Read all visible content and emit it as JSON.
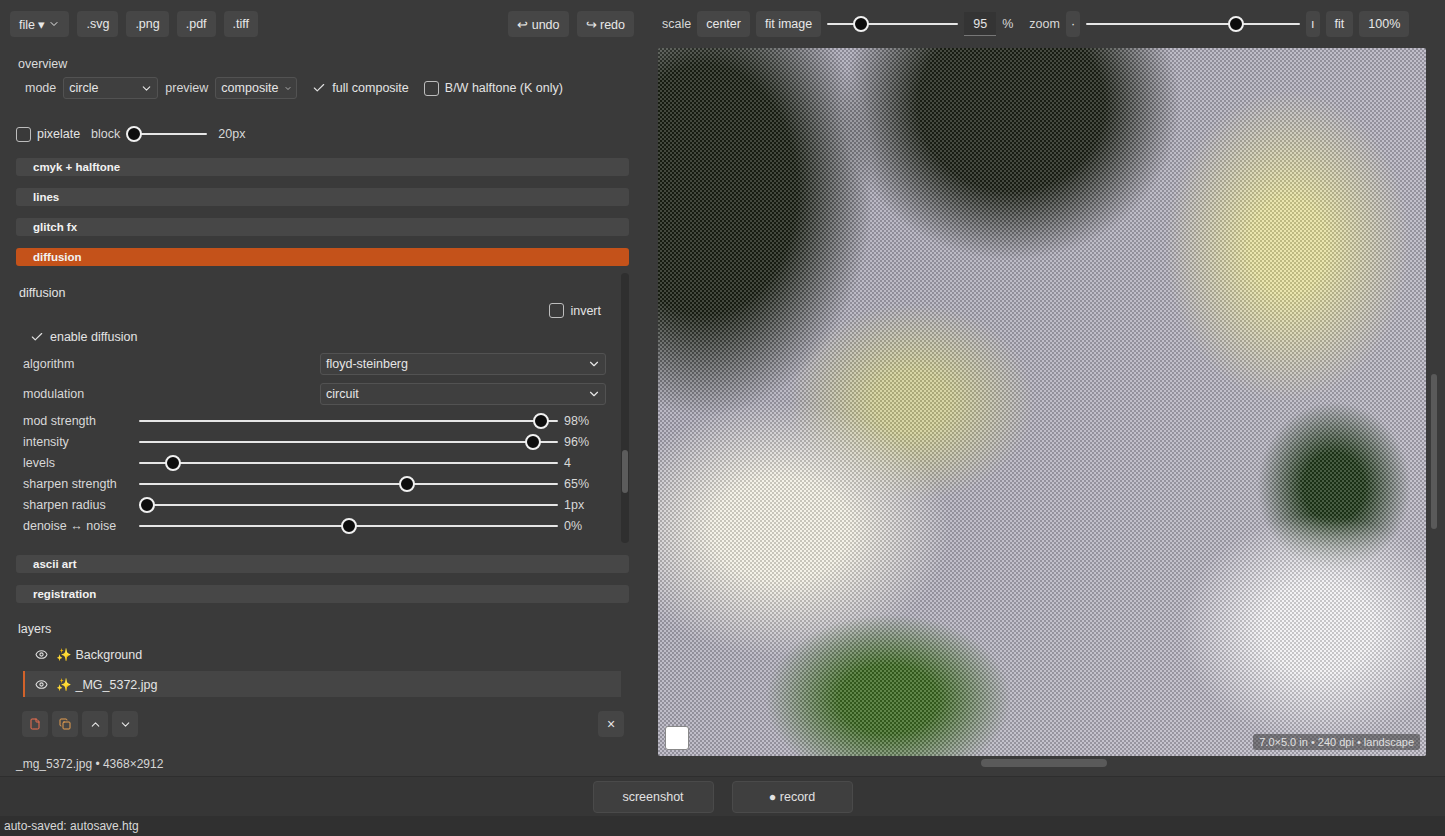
{
  "toolbar": {
    "file_menu": "file ▾",
    "exports": [
      ".svg",
      ".png",
      ".pdf",
      ".tiff"
    ],
    "undo": "↩ undo",
    "redo": "↪ redo"
  },
  "view": {
    "scale_label": "scale",
    "center": "center",
    "fit_image": "fit image",
    "scale_level": 0.26,
    "scale_value": "95",
    "percent": "%",
    "zoom_label": "zoom",
    "zoom_out": "·",
    "zoom_level": 0.7,
    "zoom_in": "ı",
    "fit": "fit",
    "actual": "100%"
  },
  "overview": {
    "title": "overview",
    "mode_label": "mode",
    "mode": "circle",
    "preview_label": "preview",
    "preview": "composite",
    "options": [
      {
        "label": "full composite",
        "checked": true
      },
      {
        "label": "B/W halftone (K only)",
        "checked": false
      }
    ],
    "pixelate": {
      "label": "pixelate",
      "checked": false
    },
    "block_label": "block",
    "block_level": 0.08,
    "block_value": "20px"
  },
  "sections": [
    {
      "label": "cmyk + halftone",
      "expanded": false
    },
    {
      "label": "lines",
      "expanded": false
    },
    {
      "label": "glitch fx",
      "expanded": false
    },
    {
      "label": "diffusion",
      "expanded": true
    },
    {
      "label": "ascii art",
      "expanded": false
    },
    {
      "label": "registration",
      "expanded": false
    }
  ],
  "diffusion": {
    "title": "diffusion",
    "invert": {
      "label": "invert",
      "checked": false
    },
    "enable": {
      "label": "enable diffusion",
      "checked": true
    },
    "selects": [
      {
        "label": "algorithm",
        "value": "floyd-steinberg"
      },
      {
        "label": "modulation",
        "value": "circuit"
      }
    ],
    "sliders": [
      {
        "label": "mod strength",
        "level": 0.96,
        "value": "98%"
      },
      {
        "label": "intensity",
        "level": 0.94,
        "value": "96%"
      },
      {
        "label": "levels",
        "level": 0.08,
        "value": "4"
      },
      {
        "label": "sharpen strength",
        "level": 0.64,
        "value": "65%"
      },
      {
        "label": "sharpen radius",
        "level": 0.02,
        "value": "1px"
      },
      {
        "label": "denoise ↔ noise",
        "level": 0.5,
        "value": "0%"
      }
    ],
    "scroll_level": 0.78
  },
  "layers": {
    "title": "layers",
    "items": [
      {
        "name": "✨ Background",
        "selected": false,
        "visible": true
      },
      {
        "name": "✨ _MG_5372.jpg",
        "selected": true,
        "visible": true
      }
    ],
    "close": "×"
  },
  "file_info": "_mg_5372.jpg • 4368×2912",
  "canvas": {
    "badge": "7.0×5.0 in • 240 dpi • landscape",
    "swatch_color": "#ffffff",
    "h_scroll_level": 0.42,
    "v_scroll_level": 0.46
  },
  "capture": [
    "screenshot",
    "● record"
  ],
  "status": "auto-saved: autosave.htg"
}
